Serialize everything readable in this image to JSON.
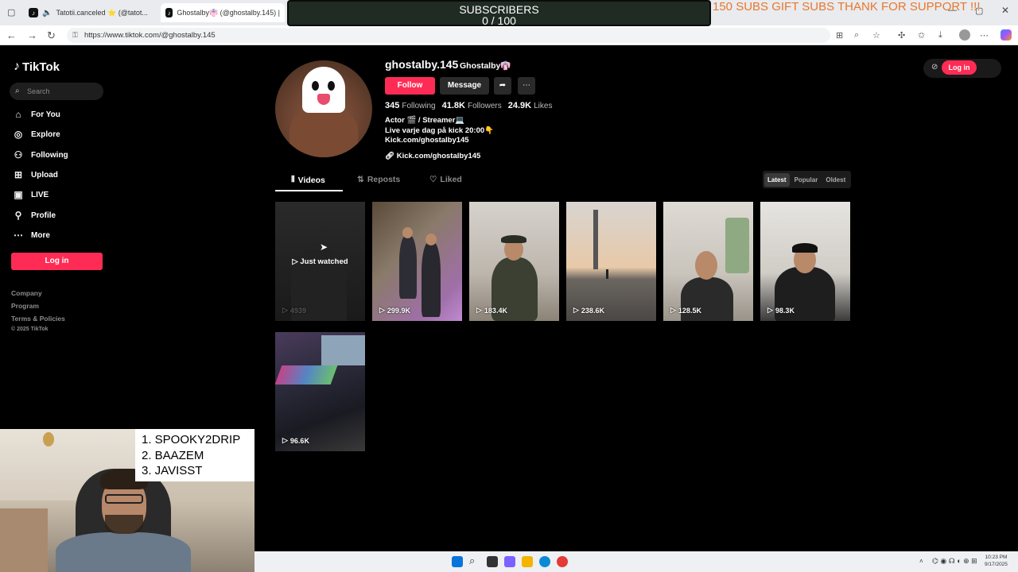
{
  "browser": {
    "tabs": [
      {
        "label": "Tatotii.canceled ⭐ (@tatot..."
      },
      {
        "label": "Ghostalby👘 (@ghostalby.145) |"
      }
    ],
    "url": "https://www.tiktok.com/@ghostalby.145"
  },
  "overlay": {
    "subs_title": "SUBSCRIBERS",
    "subs_count": "0 / 100",
    "gift_text": "150 SUBS GIFT SUBS THANK FOR SUPPORT !!!"
  },
  "sidebar": {
    "logo": "TikTok",
    "search_placeholder": "Search",
    "items": [
      {
        "label": "For You",
        "icon": "home-icon"
      },
      {
        "label": "Explore",
        "icon": "compass-icon"
      },
      {
        "label": "Following",
        "icon": "following-icon"
      },
      {
        "label": "Upload",
        "icon": "plus-square-icon"
      },
      {
        "label": "LIVE",
        "icon": "live-icon"
      },
      {
        "label": "Profile",
        "icon": "profile-icon"
      },
      {
        "label": "More",
        "icon": "more-icon"
      }
    ],
    "login_label": "Log in",
    "footer": [
      "Company",
      "Program",
      "Terms & Policies",
      "© 2025 TikTok"
    ]
  },
  "header": {
    "login_label": "Log in"
  },
  "profile": {
    "username": "ghostalby.145",
    "nickname": "Ghostalby👘",
    "follow_label": "Follow",
    "message_label": "Message",
    "stats": [
      {
        "value": "345",
        "label": "Following"
      },
      {
        "value": "41.8K",
        "label": "Followers"
      },
      {
        "value": "24.9K",
        "label": "Likes"
      }
    ],
    "bio": [
      "Actor 🎬 / Streamer💻",
      "Live varje dag på kick 20:00👇",
      "Kick.com/ghostalby145"
    ],
    "link": "Kick.com/ghostalby145"
  },
  "tabs": [
    {
      "label": "Videos"
    },
    {
      "label": "Reposts"
    },
    {
      "label": "Liked"
    }
  ],
  "sort": [
    "Latest",
    "Popular",
    "Oldest"
  ],
  "videos": [
    {
      "views": "4939",
      "overlay": "Just watched"
    },
    {
      "views": "299.9K"
    },
    {
      "views": "183.4K"
    },
    {
      "views": "238.6K"
    },
    {
      "views": "128.5K"
    },
    {
      "views": "98.3K"
    },
    {
      "views": "96.6K"
    }
  ],
  "chat": [
    "1.  SPOOKY2DRIP",
    "2.  BAAZEM",
    "3.  JAVISST"
  ],
  "clock": {
    "time": "10:23 PM",
    "date": "9/17/2025"
  }
}
